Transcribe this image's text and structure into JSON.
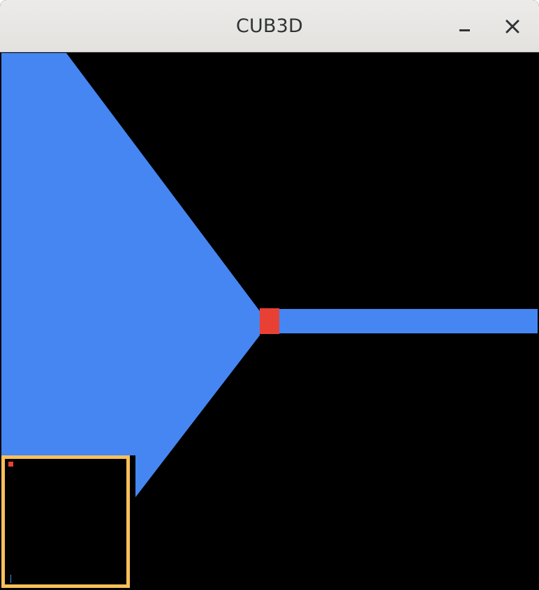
{
  "window": {
    "title": "CUB3D",
    "minimize_icon": "minimize-icon",
    "close_icon": "close-icon"
  },
  "colors": {
    "titlebar": "#e8e6e3",
    "title_text": "#2e3436",
    "background": "#000000",
    "field_of_view": "#4586f2",
    "player": "#e94035",
    "minimap_border": "#f9c05a"
  }
}
